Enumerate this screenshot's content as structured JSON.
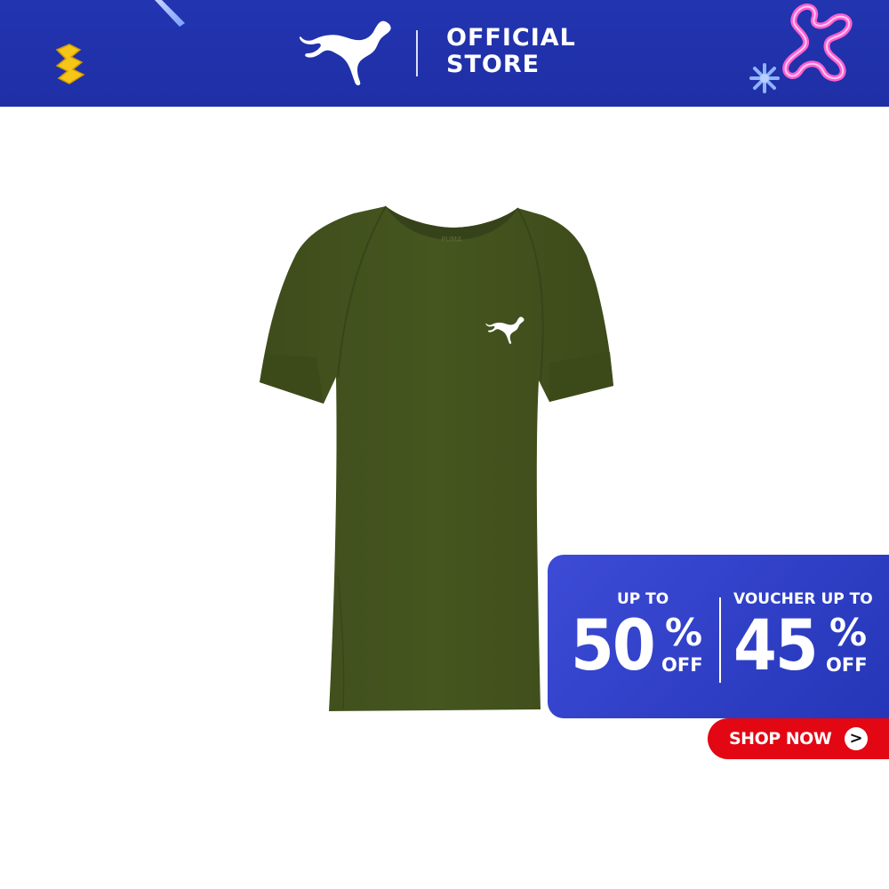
{
  "header": {
    "brand_logo": "puma-cat-logo",
    "store_line1": "OFFICIAL",
    "store_line2": "STORE",
    "background_color": "#1f2fa6"
  },
  "product": {
    "image": "green-tshirt",
    "color": "#44531f",
    "chest_logo": "puma-cat-logo"
  },
  "promo": {
    "left": {
      "caption": "UP TO",
      "value": "50",
      "percent": "%",
      "off": "OFF"
    },
    "right": {
      "caption": "VOUCHER UP TO",
      "value": "45",
      "percent": "%",
      "off": "OFF"
    },
    "background_color": "#2f3fc4"
  },
  "cta": {
    "label": "SHOP NOW",
    "arrow": ">",
    "color": "#e30613"
  }
}
